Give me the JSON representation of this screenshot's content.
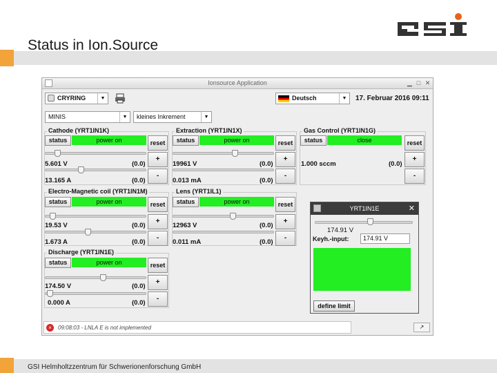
{
  "slide": {
    "title": "Status in Ion.Source",
    "footer": "GSI Helmholtzzentrum für Schwerionenforschung GmbH",
    "brand": "GSI",
    "accent_color": "#f2a33a"
  },
  "window": {
    "title": "Ionsource Application"
  },
  "toolbar": {
    "machine": "CRYRING",
    "language": "Deutsch",
    "datetime": "17. Februar 2016 09:11",
    "source": "MINIS",
    "increment": "kleines Inkrement"
  },
  "common": {
    "status_label": "status",
    "reset_label": "reset",
    "plus": "+",
    "minus": "-",
    "step": "(0.0)"
  },
  "groups": {
    "cathode": {
      "title": "Cathode (YRT1IN1K)",
      "state": "power on",
      "v1": "5.601 V",
      "v2": "13.165 A"
    },
    "extraction": {
      "title": "Extraction (YRT1IN1X)",
      "state": "power on",
      "v1": "19961 V",
      "v2": "0.013 mA"
    },
    "gas": {
      "title": "Gas Control (YRT1IN1G)",
      "state": "close",
      "v1": "1.000 sccm"
    },
    "electromag": {
      "title": "Electro-Magnetic coil (YRT1IN1M)",
      "state": "power on",
      "v1": "19.53 V",
      "v2": "1.673 A"
    },
    "lens": {
      "title": "Lens (YRT1IL1)",
      "state": "power on",
      "v1": "12963 V",
      "v2": "0.011 mA"
    },
    "discharge": {
      "title": "Discharge (YRT1IN1E)",
      "state": "power on",
      "v1": "174.50 V",
      "v2": "0.000 A"
    }
  },
  "sliders": {
    "cathode_1": 0.1,
    "cathode_2": 0.35,
    "extraction_1": 0.62,
    "electromag_1": 0.05,
    "electromag_2": 0.42,
    "lens_1": 0.6,
    "discharge_1": 0.58,
    "discharge_2": 0.02,
    "dialog": 0.57
  },
  "dialog": {
    "title": "YRT1IN1E",
    "value": "174.91 V",
    "keyh_label": "Keyh.-input:",
    "keyh_value": "174.91 V",
    "green_lines": [
      "",
      "",
      "",
      ""
    ],
    "define_label": "define limit"
  },
  "statusbar": {
    "message": "09:08:03 - LNLA E is not implemented",
    "error_symbol": "×",
    "corner": "↗"
  }
}
